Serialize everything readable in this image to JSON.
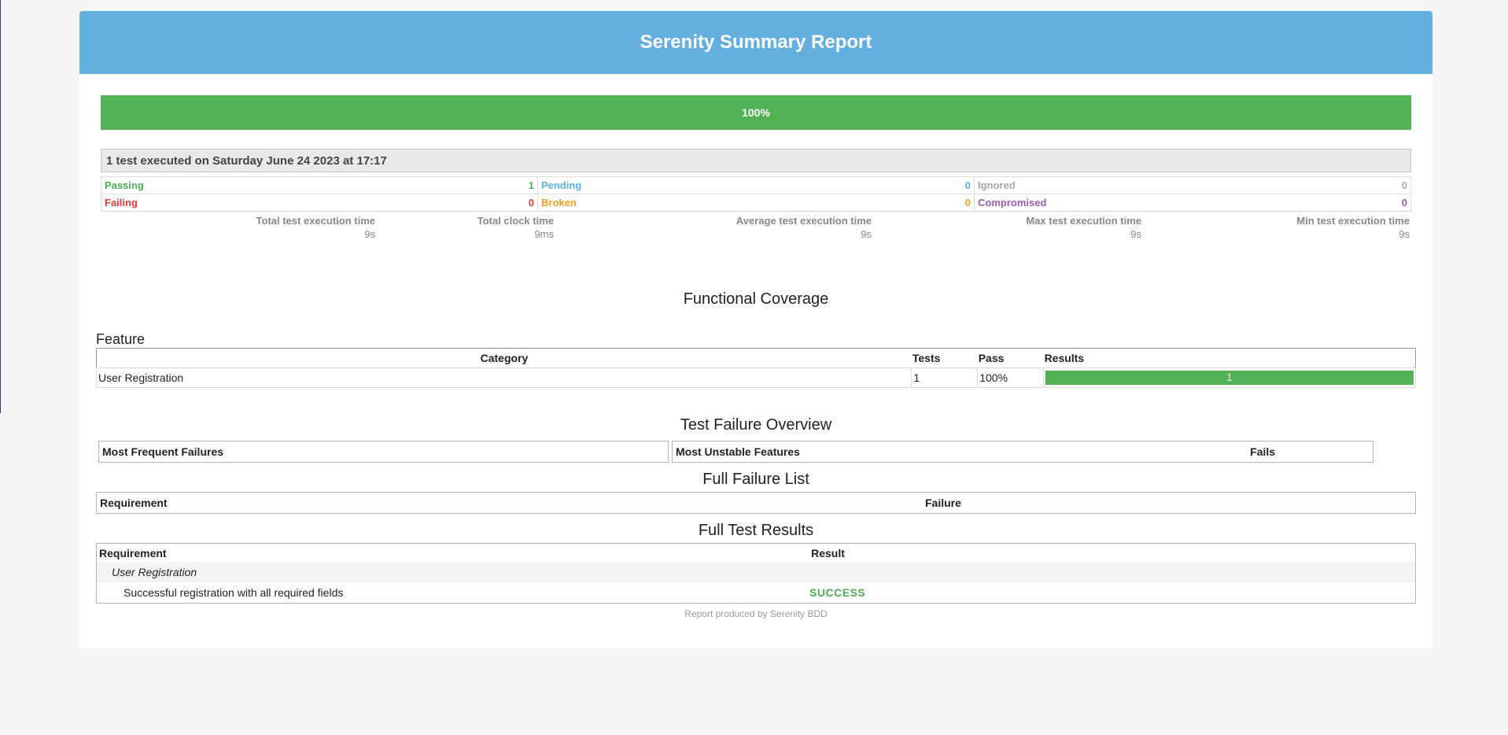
{
  "banner": {
    "title": "Serenity Summary Report"
  },
  "progress": {
    "label": "100%",
    "fraction": 1.0
  },
  "summary": {
    "executed_text": "1 test executed on Saturday June 24 2023 at 17:17"
  },
  "counts": {
    "passing": {
      "label": "Passing",
      "value": "1"
    },
    "pending": {
      "label": "Pending",
      "value": "0"
    },
    "ignored": {
      "label": "Ignored",
      "value": "0"
    },
    "failing": {
      "label": "Failing",
      "value": "0"
    },
    "broken": {
      "label": "Broken",
      "value": "0"
    },
    "compromised": {
      "label": "Compromised",
      "value": "0"
    }
  },
  "timings": [
    {
      "label": "Total test execution time",
      "value": "9s"
    },
    {
      "label": "Total clock time",
      "value": "9ms"
    },
    {
      "label": "Average test execution time",
      "value": "9s"
    },
    {
      "label": "Max test execution time",
      "value": "9s"
    },
    {
      "label": "Min test execution time",
      "value": "9s"
    }
  ],
  "coverage": {
    "title": "Functional Coverage",
    "feature_label": "Feature",
    "headers": {
      "category": "Category",
      "tests": "Tests",
      "pass": "Pass",
      "results": "Results"
    },
    "rows": [
      {
        "category": "User Registration",
        "tests": "1",
        "pass": "100%",
        "result_bar": "1"
      }
    ]
  },
  "failure_overview": {
    "title": "Test Failure Overview",
    "most_frequent": "Most Frequent Failures",
    "most_unstable": "Most Unstable Features",
    "fails": "Fails"
  },
  "failure_list": {
    "title": "Full Failure List",
    "requirement": "Requirement",
    "failure": "Failure"
  },
  "test_results": {
    "title": "Full Test Results",
    "requirement": "Requirement",
    "result": "Result",
    "group": "User Registration",
    "rows": [
      {
        "name": "Successful registration with all required fields",
        "result": "SUCCESS"
      }
    ]
  },
  "footer": {
    "text": "Report produced by Serenity BDD"
  },
  "colors": {
    "banner": "#62afe0",
    "success": "#52b356",
    "failing": "#e53935",
    "pending": "#5bb3e0",
    "broken": "#f4a020",
    "compromised": "#9b59b6",
    "ignored": "#a9a9a9"
  }
}
